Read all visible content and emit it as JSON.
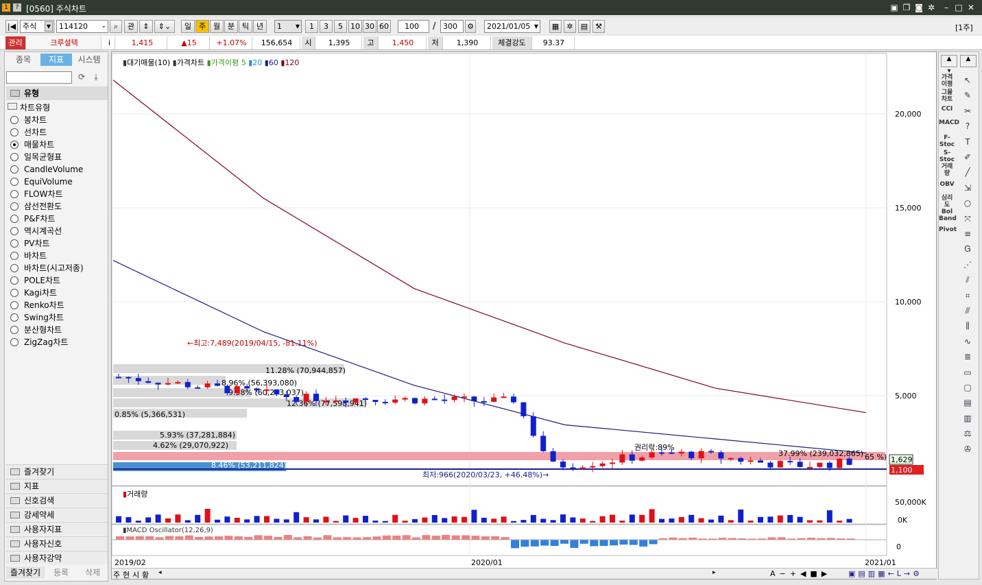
{
  "window": {
    "title": "[0560] 주식차트",
    "icon1": "1",
    "icon2": "?"
  },
  "toolbar": {
    "market": "주식",
    "code": "114120",
    "gwan": "관",
    "periods": [
      "일",
      "주",
      "월",
      "분",
      "틱",
      "년"
    ],
    "active_period": "주",
    "unit": "1",
    "nums": [
      "1",
      "3",
      "5",
      "10",
      "30",
      "60"
    ],
    "zoom": "100",
    "total": "300",
    "date": "2021/01/05",
    "right_label": "[1주]"
  },
  "quote": {
    "status": "관리",
    "name": "크루셜텍",
    "price": "1,415",
    "change": "▲15",
    "pct": "+1.07%",
    "volume": "156,654",
    "open_label": "시",
    "open": "1,395",
    "high_label": "고",
    "high": "1,450",
    "low_label": "저",
    "low": "1,390",
    "strength_label": "체결강도",
    "strength": "93.37"
  },
  "left": {
    "tabs": [
      "종목",
      "지표",
      "시스템"
    ],
    "active_tab": "지표",
    "section": "유형",
    "group": "차트유형",
    "types": [
      "봉차트",
      "선차트",
      "매물차트",
      "일목균형표",
      "CandleVolume",
      "EquiVolume",
      "FLOW차트",
      "삼선전환도",
      "P&F차트",
      "역시계곡선",
      "PV차트",
      "바차트",
      "바차트(시고저종)",
      "POLE차트",
      "Kagi차트",
      "Renko차트",
      "Swing차트",
      "분산형차트",
      "ZigZag차트"
    ],
    "selected": "매물차트",
    "folders": [
      "즐겨찾기",
      "지표",
      "신호검색",
      "강세약세",
      "사용자지표",
      "사용자신호",
      "사용자강약"
    ],
    "bottom_tabs": [
      "즐겨찾기",
      "등록",
      "삭제"
    ]
  },
  "chart": {
    "legend": {
      "vp": "대기매물(10)",
      "price": "가격차트",
      "ma_label": "가격이평",
      "ma5": "5",
      "ma20": "20",
      "ma60": "60",
      "ma120": "120"
    },
    "annot": {
      "high": "←최고:7,489(2019/04/15, -81.11%)",
      "low": "최저:966(2020/03/23, +46.48%)→",
      "right_pct": "37.99% (239,032,865)",
      "ratio": "권리락:89%",
      "ma_tag": "65 %)"
    },
    "vp_labels": [
      "11.28% (70,944,857)",
      "8.96% (56,393,080)",
      "9.58% (60,273,037)",
      "12.36% (77,598,941)",
      "0.85% (5,366,531)",
      "5.93% (37,281,884)",
      "4.62% (29,070,922)",
      "8.46% (53,211,824)"
    ],
    "price_ticks": [
      "20,000",
      "15,000",
      "10,000",
      "5,000"
    ],
    "cur_price": "1,629",
    "cur_price2": "1,100",
    "volume_label": "거래량",
    "vol_ticks": [
      "50,000K",
      "0K"
    ],
    "macd_label": "MACD Oscillator(12,26,9)",
    "macd_tick": "0",
    "xlabels": [
      "2019/02",
      "2020/01",
      "2021/01"
    ],
    "bottom_tabs": [
      "주",
      "현",
      "시",
      "황"
    ],
    "colors": {
      "up": "#e0101a",
      "down": "#1020d0",
      "ma5": "#3a9a1a",
      "ma20": "#1e90e0",
      "ma60": "#1a1a80",
      "ma120": "#800020"
    }
  },
  "chart_data": {
    "type": "candlestick",
    "title": "",
    "ylabel": "",
    "ylim": [
      0,
      22000
    ],
    "ma60_x": [
      0,
      20,
      40,
      60,
      80,
      100
    ],
    "ma60_y": [
      12200,
      8400,
      5550,
      3450,
      2700,
      1950
    ],
    "ma120_x": [
      0,
      20,
      40,
      60,
      80,
      100
    ],
    "ma120_y": [
      21800,
      15500,
      10700,
      7800,
      5400,
      4100
    ],
    "high": 7489,
    "low": 966,
    "last": 1415
  },
  "rightbar": {
    "indicators": [
      "가격이평",
      "그물차트",
      "CCI",
      "MACD",
      "F-Stoc",
      "S-Stoc",
      "거래량",
      "OBV",
      "심리도",
      "Bol Band",
      "Pivot"
    ]
  }
}
